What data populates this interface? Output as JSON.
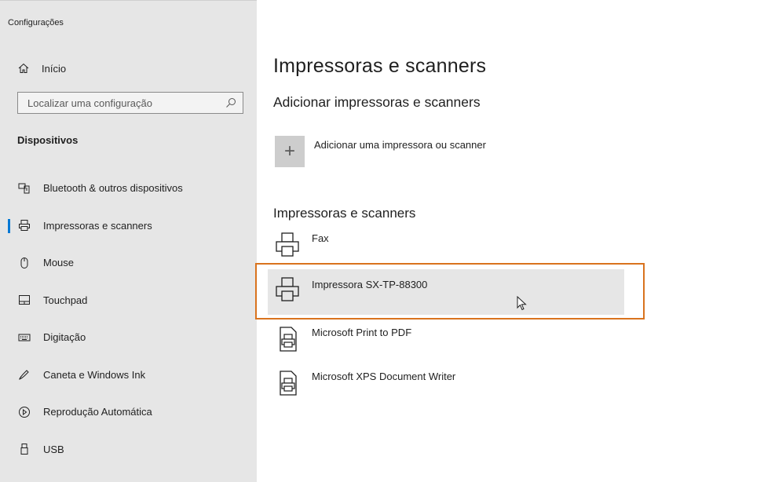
{
  "window": {
    "title": "Configurações"
  },
  "sidebar": {
    "home_label": "Início",
    "search": {
      "placeholder": "Localizar uma configuração"
    },
    "section_heading": "Dispositivos",
    "items": [
      {
        "label": "Bluetooth & outros dispositivos",
        "icon": "bluetooth-devices-icon",
        "active": false
      },
      {
        "label": "Impressoras e scanners",
        "icon": "printer-icon",
        "active": true
      },
      {
        "label": "Mouse",
        "icon": "mouse-icon",
        "active": false
      },
      {
        "label": "Touchpad",
        "icon": "touchpad-icon",
        "active": false
      },
      {
        "label": "Digitação",
        "icon": "keyboard-icon",
        "active": false
      },
      {
        "label": "Caneta e Windows Ink",
        "icon": "pen-icon",
        "active": false
      },
      {
        "label": "Reprodução Automática",
        "icon": "autoplay-icon",
        "active": false
      },
      {
        "label": "USB",
        "icon": "usb-icon",
        "active": false
      }
    ]
  },
  "main": {
    "title": "Impressoras e scanners",
    "add_section": {
      "heading": "Adicionar impressoras e scanners",
      "button_symbol": "+",
      "button_label": "Adicionar uma impressora ou scanner"
    },
    "list_heading": "Impressoras e scanners",
    "printers": [
      {
        "name": "Fax",
        "icon": "printer-icon",
        "selected": false
      },
      {
        "name": "Impressora SX-TP-88300",
        "icon": "printer-icon",
        "selected": true
      },
      {
        "name": "Microsoft Print to PDF",
        "icon": "document-printer-icon",
        "selected": false
      },
      {
        "name": "Microsoft XPS Document Writer",
        "icon": "document-printer-icon",
        "selected": false
      }
    ]
  },
  "colors": {
    "sidebar_bg": "#e6e6e6",
    "accent": "#0078d4",
    "highlight_border": "#d9731e",
    "selected_row_bg": "#e6e6e6"
  }
}
